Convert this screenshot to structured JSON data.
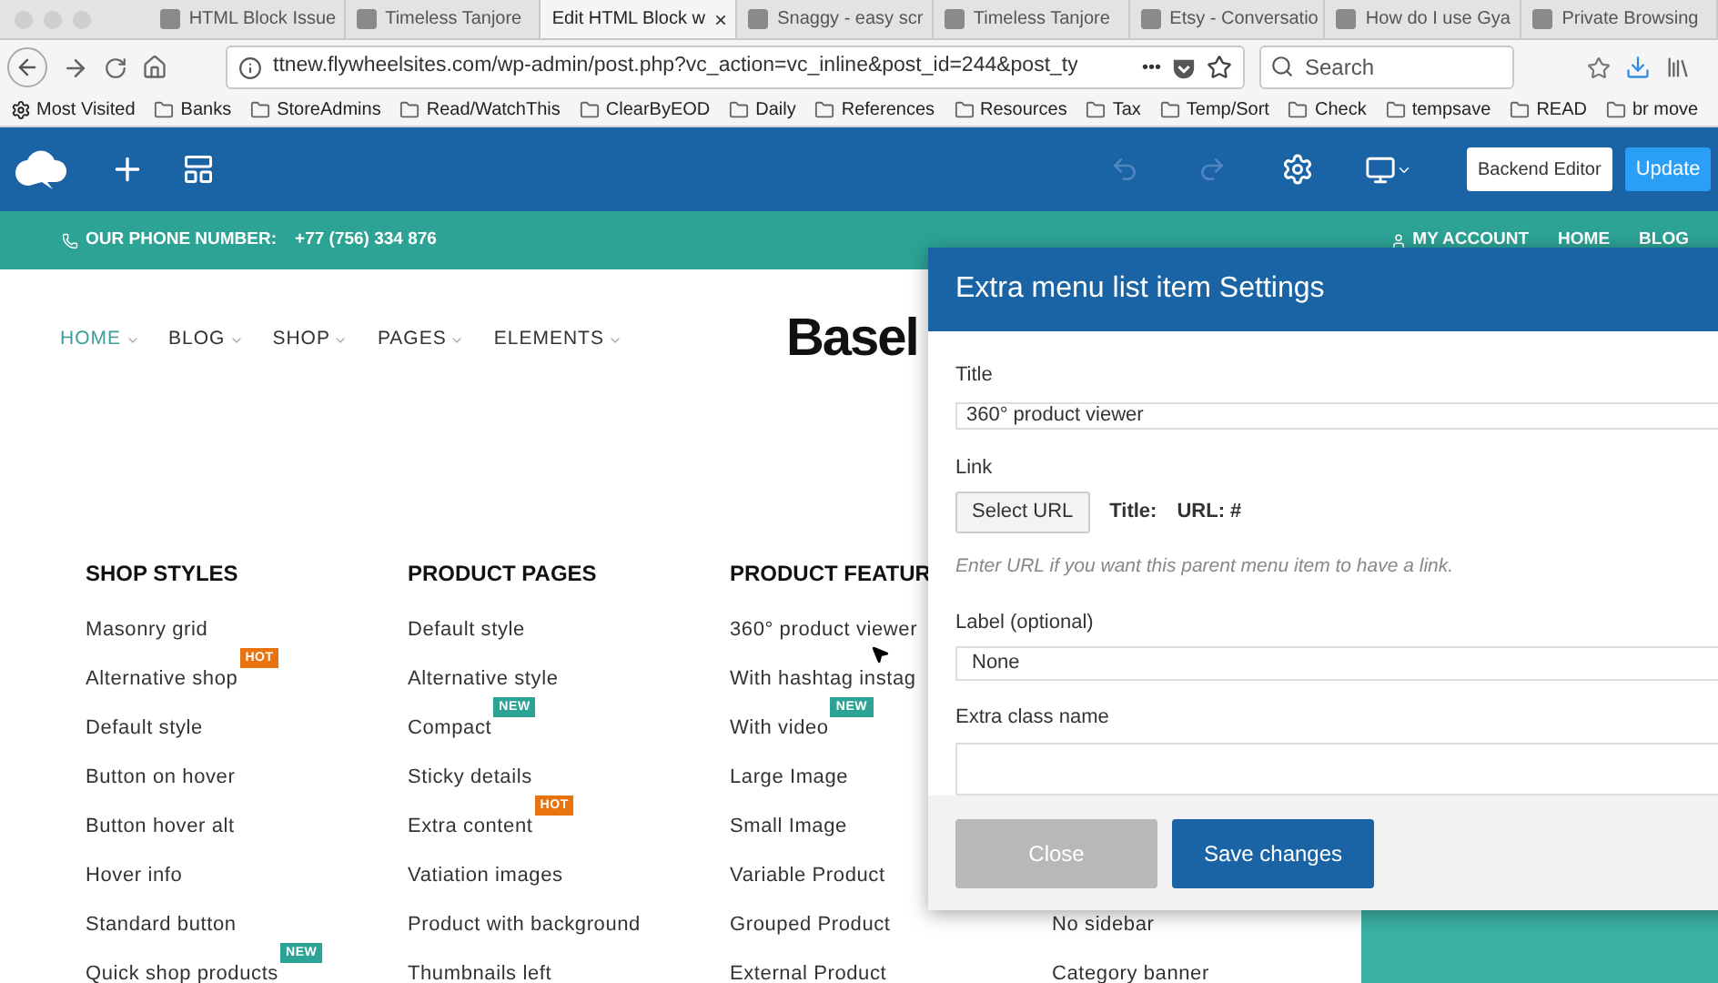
{
  "browser": {
    "tabs": [
      {
        "label": "HTML Block Issue",
        "selected": false
      },
      {
        "label": "Timeless Tanjore",
        "selected": false
      },
      {
        "label": "Edit HTML Block w",
        "selected": true
      },
      {
        "label": "Snaggy - easy scr",
        "selected": false
      },
      {
        "label": "Timeless Tanjore",
        "selected": false
      },
      {
        "label": "Etsy - Conversatio",
        "selected": false
      },
      {
        "label": "How do I use Gya",
        "selected": false
      },
      {
        "label": "Private Browsing",
        "selected": false
      }
    ],
    "close_tab": "×",
    "url": "ttnew.flywheelsites.com/wp-admin/post.php?vc_action=vc_inline&post_id=244&post_ty",
    "more": "•••",
    "search": {
      "placeholder": "Search"
    },
    "bookmarks": [
      {
        "label": "Most Visited",
        "kind": "smart"
      },
      {
        "label": "Banks",
        "kind": "folder"
      },
      {
        "label": "StoreAdmins",
        "kind": "folder"
      },
      {
        "label": "Read/WatchThis",
        "kind": "folder"
      },
      {
        "label": "ClearByEOD",
        "kind": "folder"
      },
      {
        "label": "Daily",
        "kind": "folder"
      },
      {
        "label": "References",
        "kind": "folder"
      },
      {
        "label": "Resources",
        "kind": "folder"
      },
      {
        "label": "Tax",
        "kind": "folder"
      },
      {
        "label": "Temp/Sort",
        "kind": "folder"
      },
      {
        "label": "Check",
        "kind": "folder"
      },
      {
        "label": "tempsave",
        "kind": "folder"
      },
      {
        "label": "READ",
        "kind": "folder"
      },
      {
        "label": "br move",
        "kind": "folder"
      }
    ]
  },
  "builder_toolbar": {
    "backend_editor": "Backend Editor",
    "update": "Update"
  },
  "top_bar": {
    "phone_label": "OUR PHONE NUMBER:",
    "phone": "+77 (756) 334 876",
    "links": [
      "MY ACCOUNT",
      "HOME",
      "BLOG"
    ]
  },
  "main_nav": [
    {
      "label": "HOME",
      "selected": true
    },
    {
      "label": "BLOG",
      "selected": false
    },
    {
      "label": "SHOP",
      "selected": false
    },
    {
      "label": "PAGES",
      "selected": false
    },
    {
      "label": "ELEMENTS",
      "selected": false
    }
  ],
  "logo": "Basel",
  "mega_menu": {
    "columns": [
      {
        "heading": "SHOP STYLES",
        "items": [
          {
            "label": "Masonry grid"
          },
          {
            "label": "Alternative shop",
            "badge": {
              "kind": "hot",
              "text": "HOT"
            }
          },
          {
            "label": "Default style"
          },
          {
            "label": "Button on hover"
          },
          {
            "label": "Button hover alt"
          },
          {
            "label": "Hover info"
          },
          {
            "label": "Standard button"
          },
          {
            "label": "Quick shop products",
            "badge": {
              "kind": "new",
              "text": "NEW"
            }
          }
        ]
      },
      {
        "heading": "PRODUCT PAGES",
        "items": [
          {
            "label": "Default style"
          },
          {
            "label": "Alternative style"
          },
          {
            "label": "Compact",
            "badge": {
              "kind": "new",
              "text": "NEW"
            }
          },
          {
            "label": "Sticky details"
          },
          {
            "label": "Extra content",
            "badge": {
              "kind": "hot",
              "text": "HOT"
            }
          },
          {
            "label": "Vatiation images"
          },
          {
            "label": "Product with background"
          },
          {
            "label": "Thumbnails left"
          }
        ]
      },
      {
        "heading": "PRODUCT FEATUR",
        "items": [
          {
            "label": "360° product viewer"
          },
          {
            "label": "With hashtag instag"
          },
          {
            "label": "With video",
            "badge": {
              "kind": "new",
              "text": "NEW"
            }
          },
          {
            "label": "Large Image"
          },
          {
            "label": "Small Image"
          },
          {
            "label": "Variable Product"
          },
          {
            "label": "Grouped Product"
          },
          {
            "label": "External Product"
          }
        ]
      },
      {
        "items": [
          {
            "label": "No sidebar"
          },
          {
            "label": "Category banner"
          }
        ]
      }
    ]
  },
  "dialog": {
    "title": "Extra menu list item Settings",
    "title_label": "Title",
    "title_value": "360° product viewer",
    "link_label": "Link",
    "select_url": "Select URL",
    "link_title": "Title:",
    "link_url": "URL: #",
    "link_hint": "Enter URL if you want this parent menu item to have a link.",
    "badge_label": "Label (optional)",
    "badge_value": "None",
    "class_label": "Extra class name",
    "close": "Close",
    "save": "Save changes"
  }
}
